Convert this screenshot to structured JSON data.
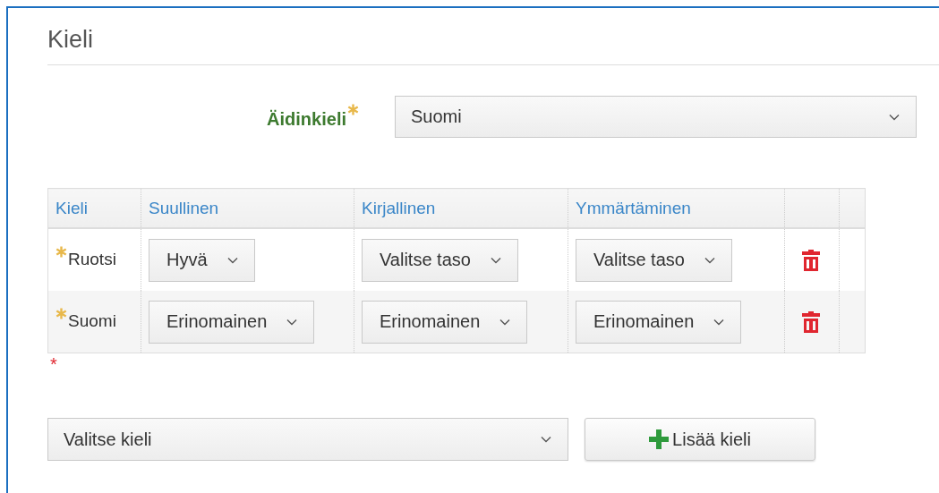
{
  "section": {
    "title": "Kieli"
  },
  "mother_tongue": {
    "label": "Äidinkieli",
    "required": true,
    "value": "Suomi"
  },
  "table": {
    "columns": [
      "Kieli",
      "Suullinen",
      "Kirjallinen",
      "Ymmärtäminen"
    ],
    "rows": [
      {
        "language": "Ruotsi",
        "required": true,
        "spoken": "Hyvä",
        "written": "Valitse taso",
        "understanding": "Valitse taso"
      },
      {
        "language": "Suomi",
        "required": true,
        "spoken": "Erinomainen",
        "written": "Erinomainen",
        "understanding": "Erinomainen"
      }
    ],
    "validation_mark": "*"
  },
  "add_language": {
    "placeholder": "Valitse kieli",
    "button": "Lisää kieli"
  }
}
